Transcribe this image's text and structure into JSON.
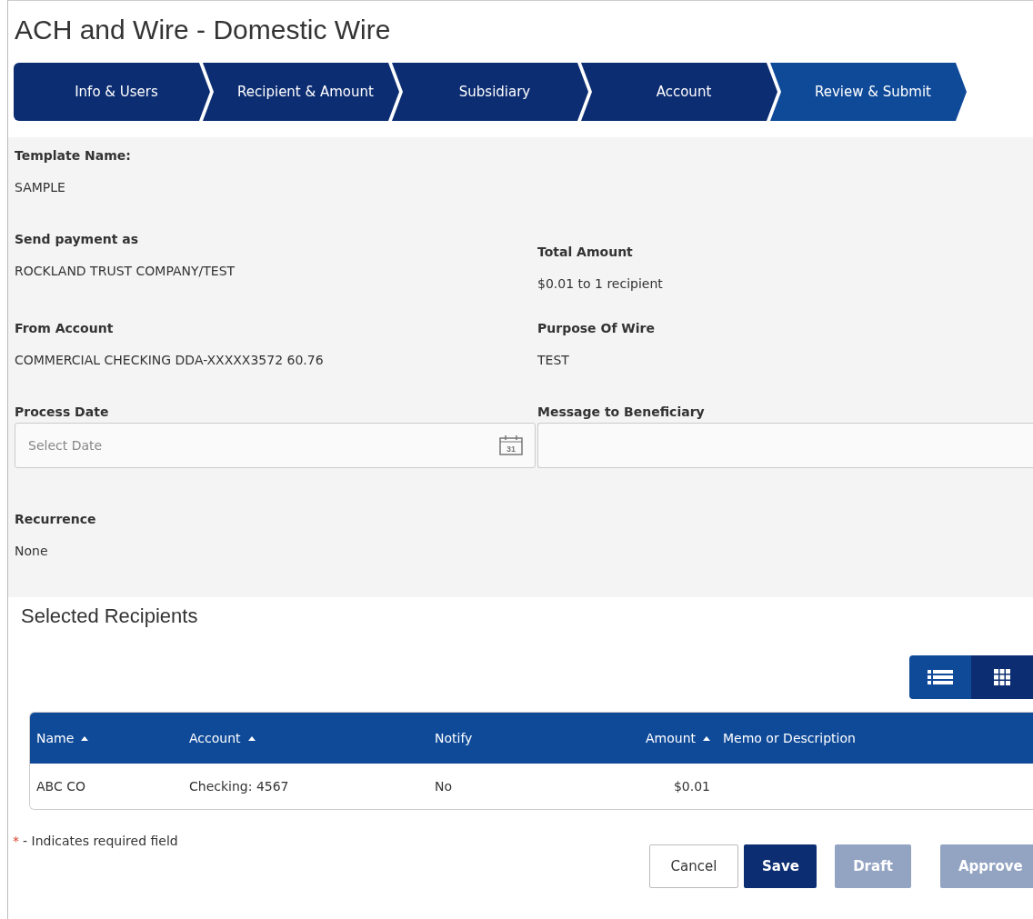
{
  "page": {
    "title": "ACH and Wire - Domestic Wire"
  },
  "steps": [
    {
      "label": "Info & Users",
      "selected": false
    },
    {
      "label": "Recipient & Amount",
      "selected": false
    },
    {
      "label": "Subsidiary",
      "selected": false
    },
    {
      "label": "Account",
      "selected": false
    },
    {
      "label": "Review & Submit",
      "selected": true
    }
  ],
  "details": {
    "rows": [
      [
        {
          "kind": "display",
          "label": "Template Name:",
          "value": "SAMPLE"
        }
      ],
      [
        {
          "kind": "display",
          "label": "Send payment as",
          "value": "ROCKLAND TRUST COMPANY/TEST"
        },
        {
          "kind": "display",
          "label": "Total Amount",
          "value": "$0.01 to 1 recipient"
        }
      ],
      [
        {
          "kind": "display",
          "label": "From Account",
          "value": "COMMERCIAL CHECKING DDA-XXXXX3572 60.76"
        },
        {
          "kind": "display",
          "label": "Purpose Of Wire",
          "value": "TEST"
        }
      ],
      [
        {
          "kind": "date",
          "label": "Process Date",
          "placeholder": "Select Date",
          "icon_text": "31"
        },
        {
          "kind": "input",
          "label": "Message to Beneficiary"
        }
      ],
      [
        {
          "kind": "display",
          "label": "Recurrence",
          "value": "None"
        }
      ]
    ]
  },
  "recipients": {
    "title": "Selected Recipients",
    "view_toggle": [
      {
        "kind": "list",
        "selected": true
      },
      {
        "kind": "grid",
        "selected": false
      }
    ],
    "columns": [
      {
        "label": "Name",
        "sortable": true
      },
      {
        "label": "Account",
        "sortable": true
      },
      {
        "label": "Notify",
        "sortable": false
      },
      {
        "label": "Amount",
        "sortable": true
      },
      {
        "label": "Memo or Description",
        "sortable": false
      }
    ],
    "rows": [
      [
        "ABC CO",
        "Checking: 4567",
        "No",
        "$0.01"
      ]
    ]
  },
  "required_note": {
    "mark": "*",
    "text": "- Indicates required field"
  },
  "buttons": [
    {
      "label": "Cancel",
      "kind": "secondary",
      "disabled": false
    },
    {
      "label": "Save",
      "kind": "primary",
      "disabled": false
    },
    {
      "label": "Draft",
      "kind": "primary",
      "disabled": true
    },
    {
      "label": "Approve",
      "kind": "primary",
      "disabled": true
    }
  ]
}
